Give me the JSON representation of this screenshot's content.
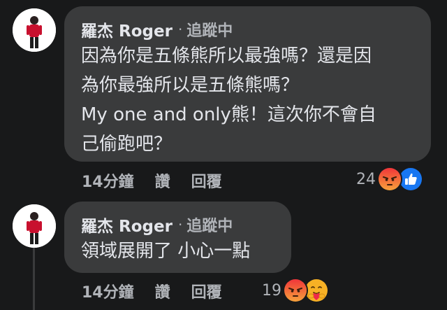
{
  "comments": [
    {
      "author": "羅杰 Roger",
      "separator": "·",
      "follow_label": "追蹤中",
      "text_lines": [
        "因為你是五條熊所以最強嗎？還是因",
        "為你最強所以是五條熊嗎？",
        "My one and only熊！這次你不會自",
        "己偷跑吧？"
      ],
      "time": "14分鐘",
      "like_label": "讚",
      "reply_label": "回覆",
      "reaction_count": "24",
      "reactions": [
        "angry-icon",
        "like-icon"
      ]
    },
    {
      "author": "羅杰 Roger",
      "separator": "·",
      "follow_label": "追蹤中",
      "text_lines": [
        "領域展開了 小心一點"
      ],
      "time": "14分鐘",
      "like_label": "讚",
      "reply_label": "回覆",
      "reaction_count": "19",
      "reactions": [
        "angry-icon",
        "care-icon"
      ]
    }
  ],
  "colors": {
    "background": "#18191a",
    "bubble": "#3a3b3c",
    "primary_text": "#e4e6eb",
    "secondary_text": "#b0b3b8",
    "like_blue": "#1877f2",
    "angry_red": "#e9710f"
  }
}
